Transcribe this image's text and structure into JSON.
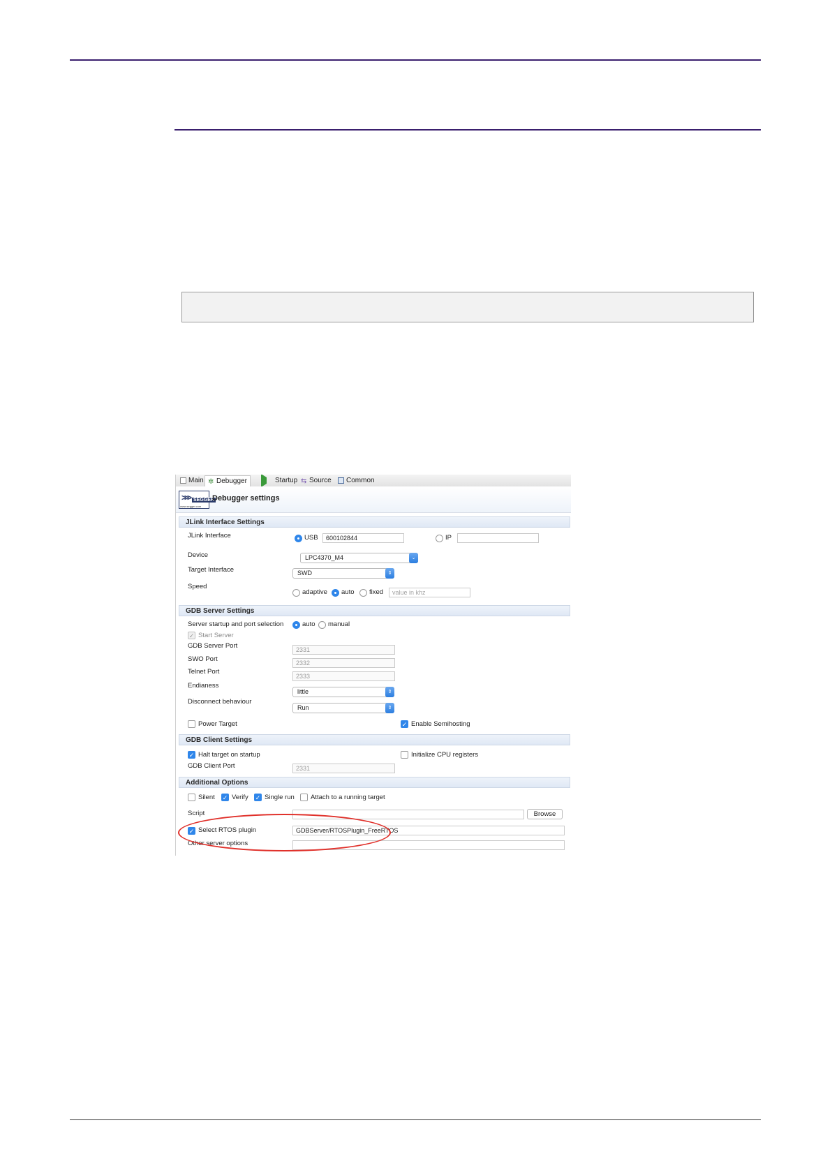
{
  "dialog": {
    "tabs": [
      "Main",
      "Debugger",
      "Startup",
      "Source",
      "Common"
    ],
    "header_title": "Debugger settings",
    "logo": {
      "name": "SEGGER",
      "url": "www.segger.com"
    },
    "jlink": {
      "section": "JLink Interface Settings",
      "interface_label": "JLink Interface",
      "usb_label": "USB",
      "usb_value": "600102844",
      "ip_label": "IP",
      "ip_value": "",
      "device_label": "Device",
      "device_value": "LPC4370_M4",
      "target_label": "Target Interface",
      "target_value": "SWD",
      "speed_label": "Speed",
      "speed_adaptive": "adaptive",
      "speed_auto": "auto",
      "speed_fixed": "fixed",
      "speed_placeholder": "value in khz"
    },
    "gdb_server": {
      "section": "GDB Server Settings",
      "startup_label": "Server startup and port selection",
      "auto": "auto",
      "manual": "manual",
      "start_server": "Start Server",
      "port_label": "GDB Server Port",
      "port_value": "2331",
      "swo_label": "SWO Port",
      "swo_value": "2332",
      "telnet_label": "Telnet Port",
      "telnet_value": "2333",
      "endianess_label": "Endianess",
      "endianess_value": "little",
      "disconnect_label": "Disconnect behaviour",
      "disconnect_value": "Run",
      "power_target": "Power Target",
      "semihosting": "Enable Semihosting"
    },
    "gdb_client": {
      "section": "GDB Client Settings",
      "halt": "Halt target on startup",
      "init_cpu": "Initialize CPU registers",
      "port_label": "GDB Client Port",
      "port_value": "2331"
    },
    "additional": {
      "section": "Additional Options",
      "silent": "Silent",
      "verify": "Verify",
      "single_run": "Single run",
      "attach": "Attach to a running target",
      "script_label": "Script",
      "browse": "Browse",
      "rtos_label": "Select RTOS plugin",
      "rtos_value": "GDBServer/RTOSPlugin_FreeRTOS",
      "other_label": "Other server options"
    },
    "highlight_color": "#e0302a",
    "accent_color": "#2f86ea"
  },
  "colors": {
    "rule": "#3a1f6e"
  }
}
